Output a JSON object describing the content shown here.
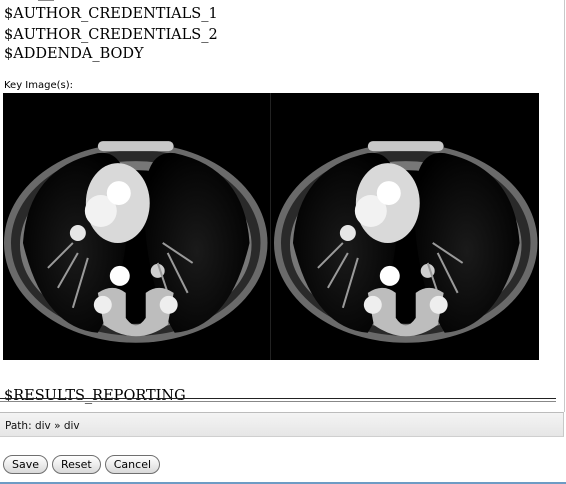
{
  "editor": {
    "lines": [
      "$AUTHOR_CREDENTIALS_1",
      "$AUTHOR_CREDENTIALS_2",
      "$ADDENDA_BODY"
    ],
    "key_images_caption": "Key Image(s):",
    "results_reporting": "$RESULTS_REPORTING"
  },
  "statusbar": {
    "path": "Path: div » div"
  },
  "buttons": {
    "save": "Save",
    "reset": "Reset",
    "cancel": "Cancel"
  },
  "colors": {
    "accent_rule": "#6d9bc4",
    "statusbar_bg": "#ececec"
  }
}
